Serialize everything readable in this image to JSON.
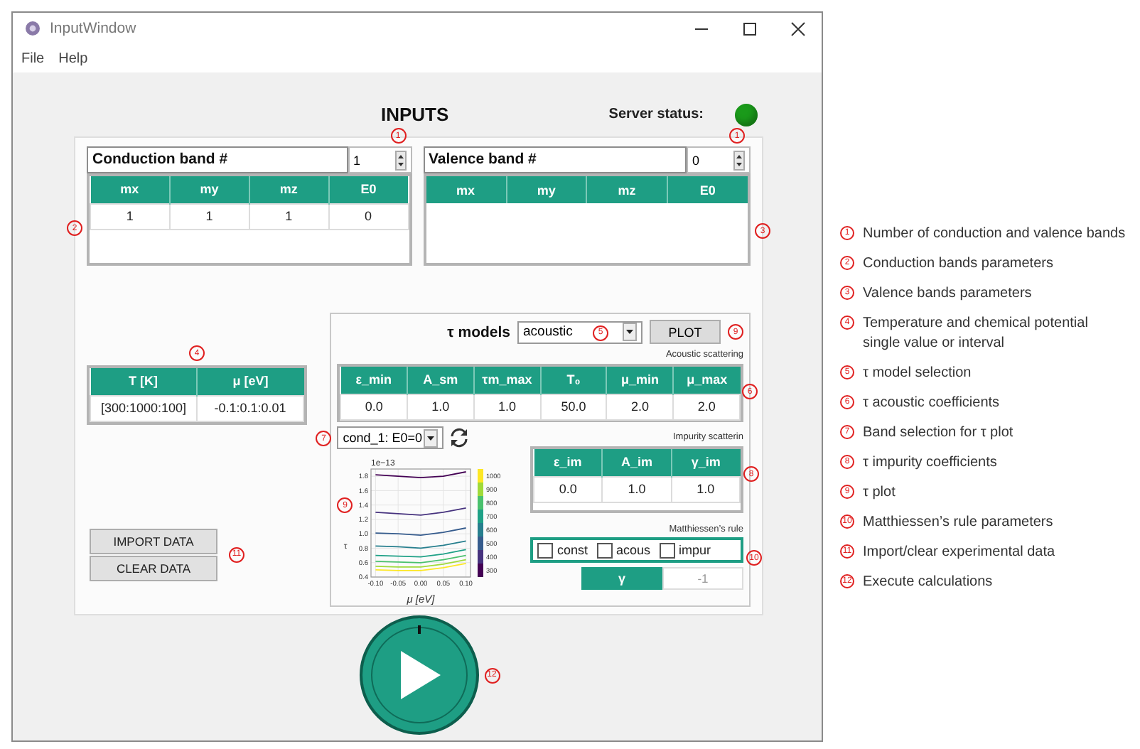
{
  "window": {
    "title": "InputWindow"
  },
  "menu": [
    "File",
    "Help"
  ],
  "heading": "INPUTS",
  "server_status": {
    "label": "Server status:",
    "online": true
  },
  "conduction_band": {
    "label": "Conduction band #",
    "count": "1",
    "count_marker": "1",
    "table_marker": "2",
    "columns": [
      "mx",
      "my",
      "mz",
      "E0"
    ],
    "rows": [
      [
        "1",
        "1",
        "1",
        "0"
      ]
    ]
  },
  "valence_band": {
    "label": "Valence band #",
    "count": "0",
    "count_marker": "1",
    "table_marker": "3",
    "columns": [
      "mx",
      "my",
      "mz",
      "E0"
    ]
  },
  "conditions": {
    "marker": "4",
    "columns": [
      "T [K]",
      "μ [eV]"
    ],
    "rows": [
      [
        "[300:1000:100]",
        "-0.1:0.1:0.01"
      ]
    ]
  },
  "data_buttons": {
    "marker": "11",
    "buttons": [
      "IMPORT DATA",
      "CLEAR DATA"
    ]
  },
  "tau": {
    "label": "τ models",
    "model": "acoustic",
    "model_marker": "5",
    "plot_button": "PLOT",
    "plot_marker": "9",
    "acoustic": {
      "title": "Acoustic scattering",
      "marker": "6",
      "columns": [
        "ε_min",
        "A_sm",
        "τm_max",
        "T₀",
        "μ_min",
        "μ_max"
      ],
      "rows": [
        [
          "0.0",
          "1.0",
          "1.0",
          "50.0",
          "2.0",
          "2.0"
        ]
      ]
    },
    "band_select": {
      "value": "cond_1: E0=0",
      "marker": "7"
    },
    "impurity": {
      "title": "Impurity scatterin",
      "marker": "8",
      "columns": [
        "ε_im",
        "A_im",
        "γ_im"
      ],
      "rows": [
        [
          "0.0",
          "1.0",
          "1.0"
        ]
      ]
    },
    "matthiessen": {
      "title": "Matthiessen’s rule",
      "marker": "10",
      "options": [
        {
          "label": "const",
          "checked": false
        },
        {
          "label": "acous",
          "checked": false
        },
        {
          "label": "impur",
          "checked": false
        }
      ],
      "gamma_label": "γ",
      "gamma_value": "-1"
    },
    "plot": {
      "marker": "9",
      "chart_data": {
        "type": "line",
        "grid": true,
        "legend": "right",
        "xlabel": "μ [eV]",
        "ylabel": "τ",
        "x": [
          -0.1,
          -0.05,
          0,
          0.05,
          0.1
        ],
        "xlim": [
          -0.11,
          0.11
        ],
        "ylim": [
          0.4,
          1.9
        ],
        "xticks": [
          {
            "value": -0.1,
            "label": "-0.10"
          },
          {
            "value": -0.05,
            "label": "-0.05"
          },
          {
            "value": 0,
            "label": "0.00"
          },
          {
            "value": 0.05,
            "label": "0.05"
          },
          {
            "value": 0.1,
            "label": "0.10"
          }
        ],
        "yticks": [
          {
            "value": 0.4,
            "label": "0.4"
          },
          {
            "value": 0.6,
            "label": "0.6"
          },
          {
            "value": 0.8,
            "label": "0.8"
          },
          {
            "value": 1,
            "label": "1.0"
          },
          {
            "value": 1.2,
            "label": "1.2"
          },
          {
            "value": 1.4,
            "label": "1.4"
          },
          {
            "value": 1.6,
            "label": "1.6"
          },
          {
            "value": 1.8,
            "label": "1.8"
          }
        ],
        "annotations": [
          "1e−13"
        ],
        "series": [
          {
            "name": "300",
            "color": "#440154",
            "values": [
              1.82,
              1.8,
              1.78,
              1.8,
              1.86
            ]
          },
          {
            "name": "400",
            "color": "#46327e",
            "values": [
              1.3,
              1.28,
              1.26,
              1.3,
              1.36
            ]
          },
          {
            "name": "500",
            "color": "#365c8d",
            "values": [
              1.01,
              1.0,
              0.98,
              1.02,
              1.08
            ]
          },
          {
            "name": "600",
            "color": "#277f8e",
            "values": [
              0.83,
              0.82,
              0.8,
              0.84,
              0.9
            ]
          },
          {
            "name": "700",
            "color": "#1fa187",
            "values": [
              0.7,
              0.69,
              0.68,
              0.72,
              0.78
            ]
          },
          {
            "name": "800",
            "color": "#4ac16d",
            "values": [
              0.62,
              0.61,
              0.6,
              0.64,
              0.7
            ]
          },
          {
            "name": "900",
            "color": "#a0da39",
            "values": [
              0.55,
              0.54,
              0.54,
              0.58,
              0.64
            ]
          },
          {
            "name": "1000",
            "color": "#fde725",
            "values": [
              0.5,
              0.49,
              0.49,
              0.53,
              0.59
            ]
          }
        ]
      }
    }
  },
  "run": {
    "marker": "12"
  },
  "legend": [
    {
      "marker": "1",
      "text": "Number of conduction and valence bands"
    },
    {
      "marker": "2",
      "text": "Conduction bands parameters"
    },
    {
      "marker": "3",
      "text": "Valence bands parameters"
    },
    {
      "marker": "4",
      "text": "Temperature and chemical potential\nsingle value or interval"
    },
    {
      "marker": "5",
      "text": "τ model selection"
    },
    {
      "marker": "6",
      "text": "τ acoustic coefficients"
    },
    {
      "marker": "7",
      "text": "Band selection for τ plot"
    },
    {
      "marker": "8",
      "text": "τ impurity coefficients"
    },
    {
      "marker": "9",
      "text": "τ plot"
    },
    {
      "marker": "10",
      "text": "Matthiessen’s rule parameters"
    },
    {
      "marker": "11",
      "text": "Import/clear experimental data"
    },
    {
      "marker": "12",
      "text": "Execute calculations"
    }
  ]
}
